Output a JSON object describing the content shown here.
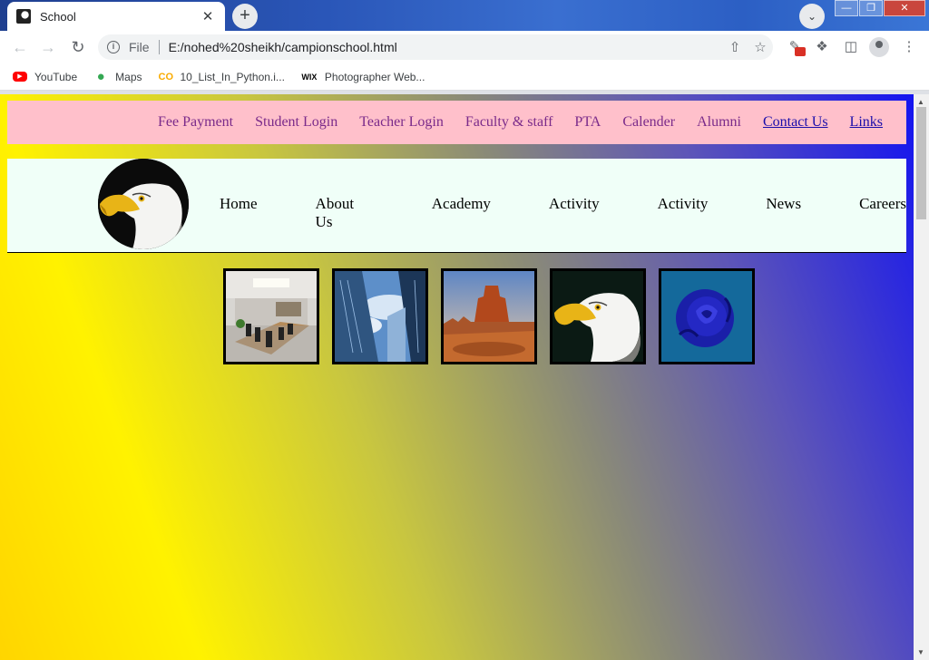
{
  "browser": {
    "tab_title": "School",
    "tab_close": "✕",
    "new_tab": "+",
    "tab_search": "⌄",
    "window_controls": [
      "—",
      "❐",
      "✕"
    ],
    "url_scheme": "File",
    "url": "E:/nohed%20sheikh/campionschool.html",
    "bookmarks": [
      {
        "label": "YouTube",
        "icon": "youtube-icon"
      },
      {
        "label": "Maps",
        "icon": "maps-icon"
      },
      {
        "label": "10_List_In_Python.i...",
        "icon": "colab-icon"
      },
      {
        "label": "Photographer Web...",
        "icon": "wix-icon"
      }
    ]
  },
  "site": {
    "top_links": [
      {
        "label": "Fee Payment",
        "style": "plain"
      },
      {
        "label": "Student Login",
        "style": "plain"
      },
      {
        "label": "Teacher Login",
        "style": "plain"
      },
      {
        "label": "Faculty & staff",
        "style": "plain"
      },
      {
        "label": "PTA",
        "style": "plain"
      },
      {
        "label": "Calender",
        "style": "plain"
      },
      {
        "label": "Alumni",
        "style": "plain"
      },
      {
        "label": "Contact Us",
        "style": "underlined"
      },
      {
        "label": "Links",
        "style": "underlined"
      }
    ],
    "main_menu": [
      "Home",
      "About Us",
      "Academy",
      "Activity",
      "Activity",
      "News",
      "Careers"
    ],
    "gallery": [
      {
        "name": "conference-room-image"
      },
      {
        "name": "skyscrapers-image"
      },
      {
        "name": "desert-rock-image"
      },
      {
        "name": "eagle-image"
      },
      {
        "name": "blue-rose-image"
      }
    ]
  },
  "colors": {
    "top_nav_bg": "#ffc0cb",
    "top_nav_link": "#7a2a8a",
    "main_nav_bg": "#f0fff8"
  }
}
